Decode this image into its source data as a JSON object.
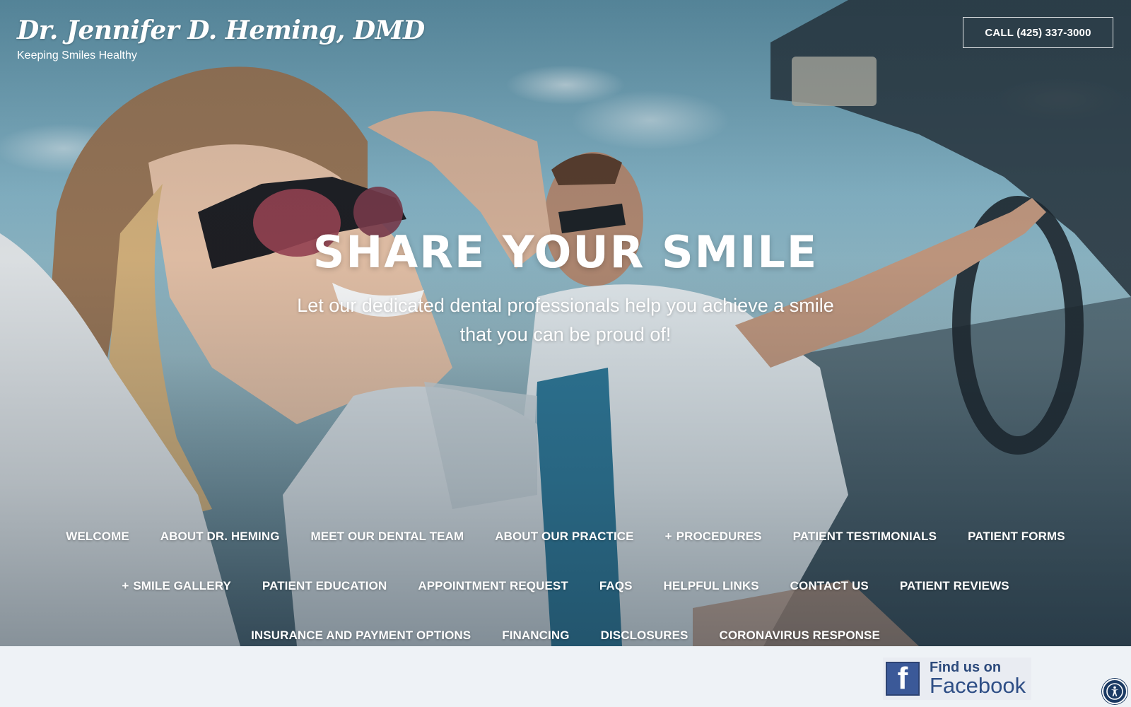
{
  "header": {
    "brand_title": "Dr. Jennifer D. Heming, DMD",
    "tagline": "Keeping Smiles Healthy",
    "call_button": "CALL (425) 337-3000"
  },
  "hero": {
    "headline": "SHARE YOUR SMILE",
    "subline": "Let our dedicated dental professionals help you achieve a smile that you can be proud of!"
  },
  "nav": {
    "row1": [
      {
        "label": "WELCOME",
        "expandable": false
      },
      {
        "label": "ABOUT DR. HEMING",
        "expandable": false
      },
      {
        "label": "MEET OUR DENTAL TEAM",
        "expandable": false
      },
      {
        "label": "ABOUT OUR PRACTICE",
        "expandable": false
      },
      {
        "label": "PROCEDURES",
        "expandable": true
      },
      {
        "label": "PATIENT TESTIMONIALS",
        "expandable": false
      },
      {
        "label": "PATIENT FORMS",
        "expandable": false
      }
    ],
    "row2": [
      {
        "label": "SMILE GALLERY",
        "expandable": true
      },
      {
        "label": "PATIENT EDUCATION",
        "expandable": false
      },
      {
        "label": "APPOINTMENT REQUEST",
        "expandable": false
      },
      {
        "label": "FAQS",
        "expandable": false
      },
      {
        "label": "HELPFUL LINKS",
        "expandable": false
      },
      {
        "label": "CONTACT US",
        "expandable": false
      },
      {
        "label": "PATIENT REVIEWS",
        "expandable": false
      }
    ],
    "row3": [
      {
        "label": "INSURANCE AND PAYMENT OPTIONS",
        "expandable": false
      },
      {
        "label": "FINANCING",
        "expandable": false
      },
      {
        "label": "DISCLOSURES",
        "expandable": false
      },
      {
        "label": "CORONAVIRUS RESPONSE",
        "expandable": false
      }
    ],
    "plus_glyph": "+"
  },
  "footer": {
    "facebook_line1": "Find us on",
    "facebook_line2": "Facebook",
    "facebook_logo_letter": "f"
  },
  "icons": {
    "accessibility": "accessibility-icon",
    "facebook": "facebook-logo-icon",
    "hero_image": "couple-in-convertible-image"
  },
  "colors": {
    "footer_bg": "#eef2f6",
    "facebook_blue": "#3b5998",
    "accessibility_bg": "#1b3a63",
    "text_on_hero": "#ffffff"
  }
}
